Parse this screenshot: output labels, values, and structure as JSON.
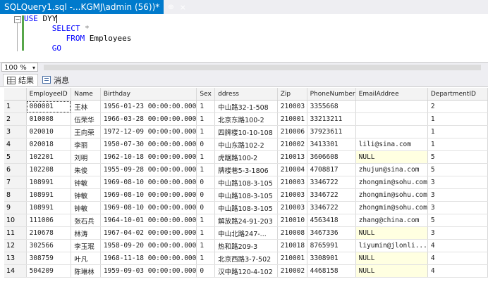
{
  "doc_tab": {
    "title": "SQLQuery1.sql -...KGMJ\\admin (56))*",
    "pin": "⊕",
    "close": "×"
  },
  "code": {
    "line1_kw": "USE",
    "line1_rest": " DYY",
    "line2_kw": "SELECT",
    "line2_rest": " *",
    "line3_kw": "FROM",
    "line3_rest": " Employees",
    "line4_kw": "GO",
    "fold": "−"
  },
  "zoom": {
    "value": "100 %",
    "arrow": "▾"
  },
  "result_tabs": [
    {
      "label": "结果"
    },
    {
      "label": "消息"
    }
  ],
  "columns": [
    "EmployeeID",
    "Name",
    "Birthday",
    "Sex",
    "ddress",
    "Zip",
    "PhoneNumber",
    "EmailAddree",
    "DepartmentID"
  ],
  "rows": [
    {
      "n": "1",
      "id": "000001",
      "name": "王林",
      "birthday": "1956-01-23 00:00:00.000",
      "sex": "1",
      "address": "中山路32-1-508",
      "zip": "210003",
      "phone": "3355668",
      "email": "",
      "dept": "2"
    },
    {
      "n": "2",
      "id": "010008",
      "name": "伍荣华",
      "birthday": "1966-03-28 00:00:00.000",
      "sex": "1",
      "address": "北京东路100-2",
      "zip": "210001",
      "phone": "33213211",
      "email": "",
      "dept": "1"
    },
    {
      "n": "3",
      "id": "020010",
      "name": "王向荣",
      "birthday": "1972-12-09 00:00:00.000",
      "sex": "1",
      "address": "四牌楼10-10-108",
      "zip": "210006",
      "phone": "37923611",
      "email": "",
      "dept": "1"
    },
    {
      "n": "4",
      "id": "020018",
      "name": "李丽",
      "birthday": "1950-07-30 00:00:00.000",
      "sex": "0",
      "address": "中山东路102-2",
      "zip": "210002",
      "phone": "3413301",
      "email": "lili@sina.com",
      "dept": "1"
    },
    {
      "n": "5",
      "id": "102201",
      "name": "刘明",
      "birthday": "1962-10-18 00:00:00.000",
      "sex": "1",
      "address": "虎踞路100-2",
      "zip": "210013",
      "phone": "3606608",
      "email": "NULL",
      "dept": "5"
    },
    {
      "n": "6",
      "id": "102208",
      "name": "朱俊",
      "birthday": "1955-09-28 00:00:00.000",
      "sex": "1",
      "address": "牌楼巷5-3-1806",
      "zip": "210004",
      "phone": "4708817",
      "email": "zhujun@sina.com",
      "dept": "5"
    },
    {
      "n": "7",
      "id": "108991",
      "name": "钟敏",
      "birthday": "1969-08-10 00:00:00.000",
      "sex": "0",
      "address": "中山路108-3-105",
      "zip": "210003",
      "phone": "3346722",
      "email": "zhongmin@sohu.com",
      "dept": "3"
    },
    {
      "n": "8",
      "id": "108991",
      "name": "钟敏",
      "birthday": "1969-08-10 00:00:00.000",
      "sex": "0",
      "address": "中山路108-3-105",
      "zip": "210003",
      "phone": "3346722",
      "email": "zhongmin@sohu.com",
      "dept": "3"
    },
    {
      "n": "9",
      "id": "108991",
      "name": "钟敏",
      "birthday": "1969-08-10 00:00:00.000",
      "sex": "0",
      "address": "中山路108-3-105",
      "zip": "210003",
      "phone": "3346722",
      "email": "zhongmin@sohu.com",
      "dept": "3"
    },
    {
      "n": "10",
      "id": "111006",
      "name": "张石兵",
      "birthday": "1964-10-01 00:00:00.000",
      "sex": "1",
      "address": "解放路24-91-203",
      "zip": "210010",
      "phone": "4563418",
      "email": "zhang@china.com",
      "dept": "5"
    },
    {
      "n": "11",
      "id": "210678",
      "name": "林涛",
      "birthday": "1967-04-02 00:00:00.000",
      "sex": "1",
      "address": "中山北路247-...",
      "zip": "210008",
      "phone": "3467336",
      "email": "NULL",
      "dept": "3"
    },
    {
      "n": "12",
      "id": "302566",
      "name": "李玉珉",
      "birthday": "1958-09-20 00:00:00.000",
      "sex": "1",
      "address": "热和路209-3",
      "zip": "210018",
      "phone": "8765991",
      "email": "liyumin@jlonli...",
      "dept": "4"
    },
    {
      "n": "13",
      "id": "308759",
      "name": "叶凡",
      "birthday": "1968-11-18 00:00:00.000",
      "sex": "1",
      "address": "北京西路3-7-502",
      "zip": "210001",
      "phone": "3308901",
      "email": "NULL",
      "dept": "4"
    },
    {
      "n": "14",
      "id": "504209",
      "name": "陈琳林",
      "birthday": "1959-09-03 00:00:00.000",
      "sex": "0",
      "address": "汉中路120-4-102",
      "zip": "210002",
      "phone": "4468158",
      "email": "NULL",
      "dept": "4"
    }
  ],
  "colors": {
    "accent": "#007acc",
    "keyword": "#0000ff",
    "null_bg": "#ffffe1",
    "change_bar": "#57a64a"
  }
}
